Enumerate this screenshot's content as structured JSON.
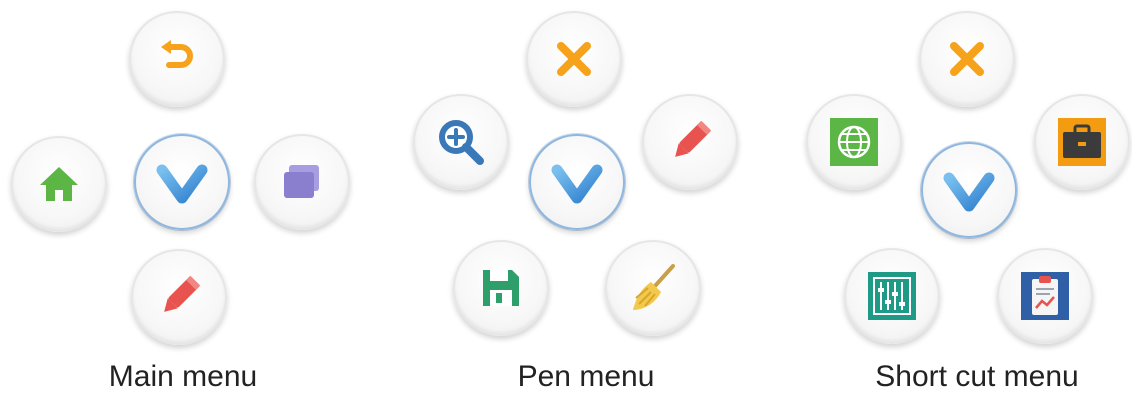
{
  "menus": [
    {
      "caption": "Main menu",
      "buttons": [
        "undo-icon",
        "home-icon",
        "logo-v-icon",
        "windows-icon",
        "pen-icon"
      ]
    },
    {
      "caption": "Pen menu",
      "buttons": [
        "close-icon",
        "zoom-in-icon",
        "logo-v-icon",
        "pen-icon",
        "save-icon",
        "broom-icon"
      ]
    },
    {
      "caption": "Short cut menu",
      "buttons": [
        "close-icon",
        "globe-icon",
        "logo-v-icon",
        "briefcase-icon",
        "equalizer-icon",
        "clipboard-icon"
      ]
    }
  ],
  "colors": {
    "orange": "#f7a21b",
    "green": "#5cb646",
    "purple": "#8a7fcf",
    "red": "#e8524f",
    "blue": "#3a78b8",
    "teal": "#1e9a86",
    "v_blue": "#4a9be0"
  }
}
